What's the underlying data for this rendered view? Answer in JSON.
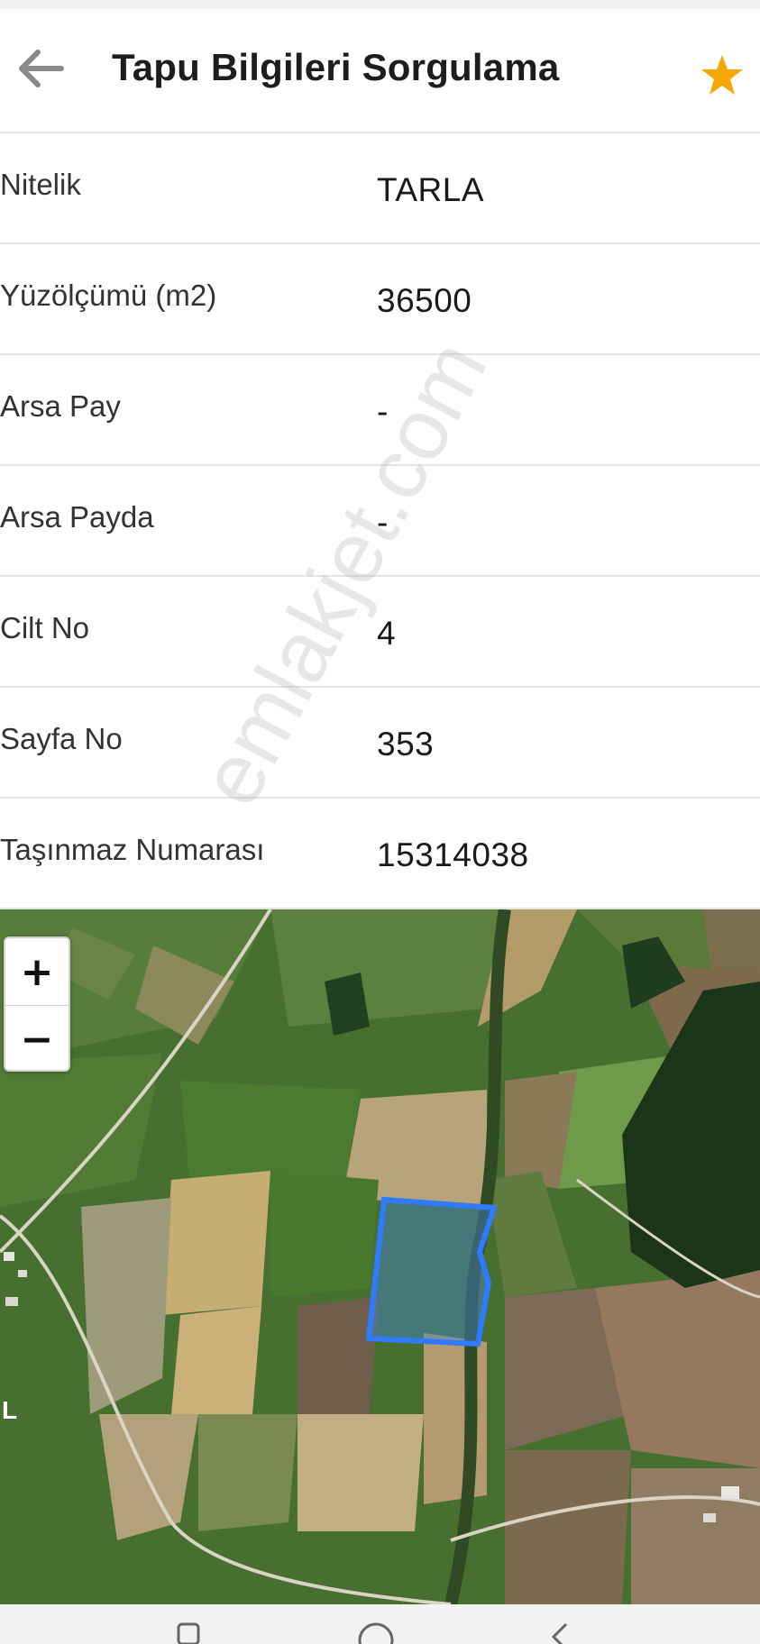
{
  "header": {
    "title": "Tapu Bilgileri Sorgulama",
    "back_icon": "back-arrow-icon",
    "favorite_icon": "star-icon",
    "favorite_color": "#F6A800"
  },
  "fields": [
    {
      "label": "Nitelik",
      "value": "TARLA"
    },
    {
      "label": "Yüzölçümü (m2)",
      "value": "36500"
    },
    {
      "label": "Arsa Pay",
      "value": "-"
    },
    {
      "label": "Arsa Payda",
      "value": "-"
    },
    {
      "label": "Cilt No",
      "value": "4"
    },
    {
      "label": "Sayfa No",
      "value": "353"
    },
    {
      "label": "Taşınmaz Numarası",
      "value": "15314038"
    }
  ],
  "map": {
    "zoom_in_label": "+",
    "zoom_out_label": "−",
    "parcel_outline_color": "#2F7BFF",
    "edge_letter": "L"
  },
  "watermark": "emlakjet.com",
  "navigation": {
    "buttons": [
      "recent-apps-icon",
      "home-icon",
      "back-icon"
    ]
  }
}
